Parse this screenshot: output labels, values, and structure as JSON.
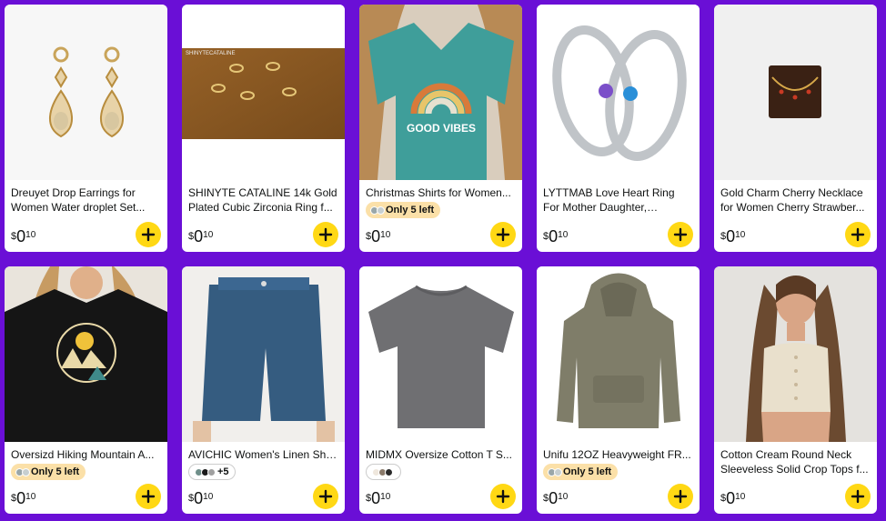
{
  "products": [
    {
      "title": "Dreuyet Drop Earrings for Women Water droplet Set...",
      "price_currency": "$",
      "price_whole": "0",
      "price_fraction": "10",
      "image": "earrings-image"
    },
    {
      "title": "SHINYTE CATALINE 14k Gold Plated Cubic Zirconia Ring f...",
      "price_currency": "$",
      "price_whole": "0",
      "price_fraction": "10",
      "image": "rings-on-wood-image",
      "image_caption": "SHINYTECATALINE"
    },
    {
      "title": "Christmas Shirts for Women...",
      "badge": "Only 5 left",
      "price_currency": "$",
      "price_whole": "0",
      "price_fraction": "10",
      "image": "good-vibes-tshirt-image",
      "image_text": "GOOD VIBES"
    },
    {
      "title": "LYTTMAB Love Heart Ring For Mother Daughter, Sterling...",
      "price_currency": "$",
      "price_whole": "0",
      "price_fraction": "10",
      "image": "heart-rings-image"
    },
    {
      "title": "Gold Charm Cherry Necklace for Women Cherry Strawber...",
      "price_currency": "$",
      "price_whole": "0",
      "price_fraction": "10",
      "image": "cherry-necklace-image"
    },
    {
      "title": "Oversizd Hiking Mountain A...",
      "badge": "Only 5 left",
      "price_currency": "$",
      "price_whole": "0",
      "price_fraction": "10",
      "image": "hiking-tshirt-image"
    },
    {
      "title": "AVICHIC Women's Linen Sho...",
      "swatch_more": "+5",
      "price_currency": "$",
      "price_whole": "0",
      "price_fraction": "10",
      "image": "linen-shorts-image"
    },
    {
      "title": "MIDMX Oversize Cotton T S...",
      "swatch_more": "",
      "price_currency": "$",
      "price_whole": "0",
      "price_fraction": "10",
      "image": "gray-tshirt-image"
    },
    {
      "title": "Unifu 12OZ Heavyweight FR...",
      "badge": "Only 5 left",
      "price_currency": "$",
      "price_whole": "0",
      "price_fraction": "10",
      "image": "hoodie-image"
    },
    {
      "title": "Cotton Cream Round Neck Sleeveless Solid Crop Tops f...",
      "price_currency": "$",
      "price_whole": "0",
      "price_fraction": "10",
      "image": "crop-top-image"
    }
  ],
  "colors": {
    "background": "#6a0fd6",
    "add_button": "#ffd814",
    "badge": "#fbe0a8"
  },
  "icons": {
    "add": "plus-icon"
  }
}
